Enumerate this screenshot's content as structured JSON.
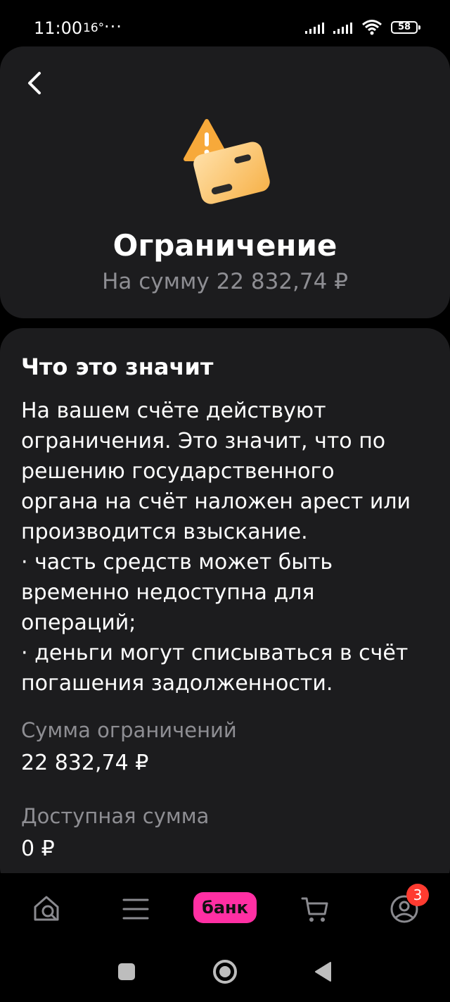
{
  "status_bar": {
    "time": "11:00",
    "temperature": "16°",
    "dots": "···",
    "battery": "58"
  },
  "header": {
    "title": "Ограничение",
    "subtitle": "На сумму 22 832,74 ₽"
  },
  "info": {
    "heading": "Что это значит",
    "body": "На вашем счёте действуют\nограничения. Это значит, что по\nрешению государственного\nоргана на счёт наложен арест или\nпроизводится взыскание.\n· часть средств может быть\nвременно недоступна для\nопераций;\n· деньги могут списываться в счёт\nпогашения задолженности.",
    "restriction_label": "Сумма ограничений",
    "restriction_value": "22 832,74 ₽",
    "available_label": "Доступная сумма",
    "available_value": "0 ₽"
  },
  "bottom_nav": {
    "items": [
      "search-home",
      "menu",
      "bank",
      "cart",
      "profile"
    ],
    "bank_label": "банк",
    "profile_badge": "3"
  },
  "colors": {
    "background": "#000000",
    "card": "#1c1c1e",
    "muted_text": "#8e8e93",
    "accent_pink": "#ff2fa3",
    "badge_red": "#ff3b30",
    "icon_orange": "#ffb74a",
    "icon_gray": "#8a8a8f"
  }
}
